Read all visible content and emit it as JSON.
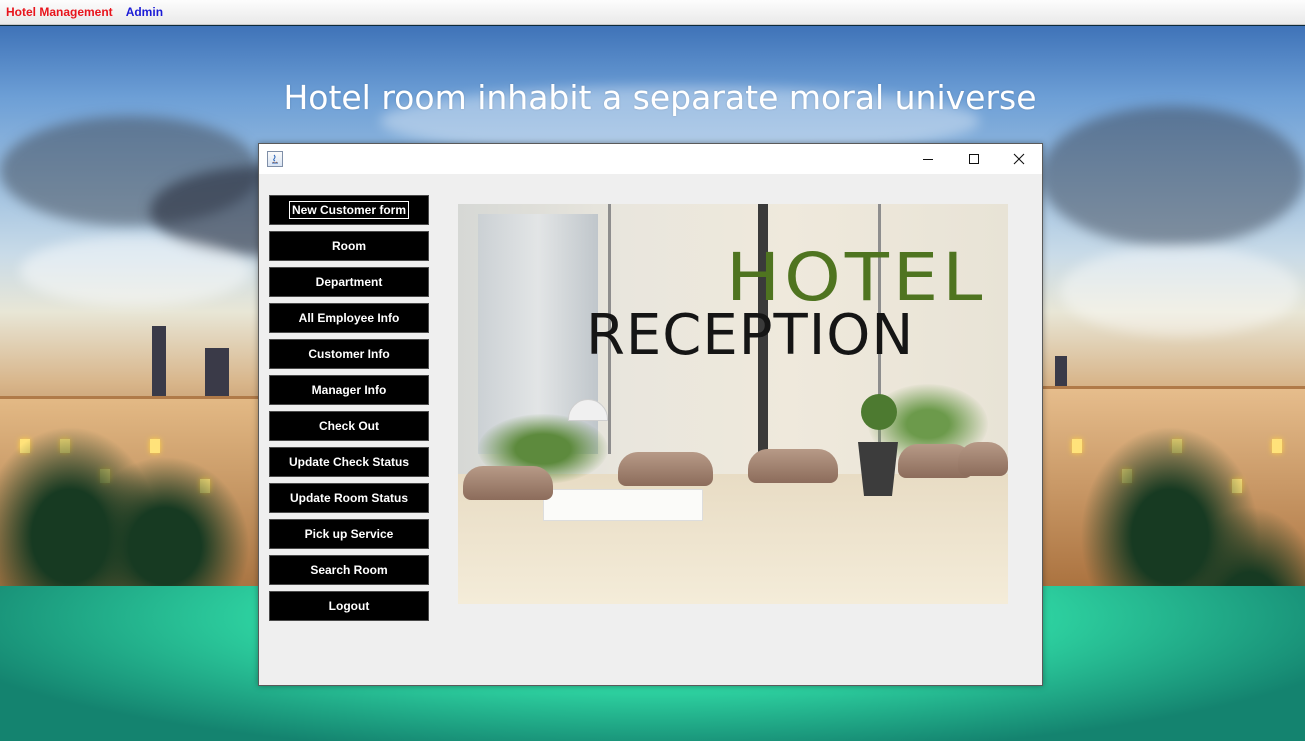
{
  "menubar": {
    "items": [
      {
        "label": "Hotel Management",
        "color": "#e8141c"
      },
      {
        "label": "Admin",
        "color": "#1b1bd6"
      }
    ]
  },
  "desktop": {
    "headline": "Hotel room inhabit a separate moral universe"
  },
  "frame": {
    "title_icon": "java-icon",
    "controls": [
      "minimize-icon",
      "maximize-icon",
      "close-icon"
    ],
    "buttons": [
      {
        "label": "New Customer form",
        "focused": true
      },
      {
        "label": "Room"
      },
      {
        "label": "Department"
      },
      {
        "label": "All Employee Info"
      },
      {
        "label": "Customer Info"
      },
      {
        "label": "Manager Info"
      },
      {
        "label": "Check Out"
      },
      {
        "label": "Update Check Status"
      },
      {
        "label": "Update Room Status"
      },
      {
        "label": "Pick up Service"
      },
      {
        "label": "Search Room"
      },
      {
        "label": "Logout"
      }
    ],
    "image": {
      "logo_line1": "HOTEL",
      "logo_line2": "RECEPTION",
      "logo_color": "#4f7420"
    }
  }
}
